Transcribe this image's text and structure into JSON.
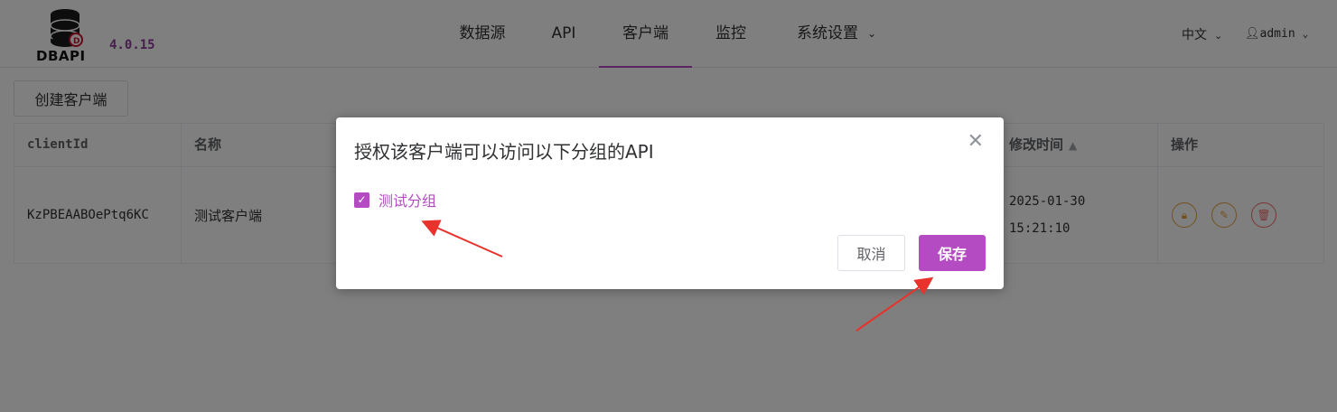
{
  "header": {
    "logo_text": "DBAPI",
    "version": "4.0.15",
    "nav": [
      {
        "label": "数据源"
      },
      {
        "label": "API"
      },
      {
        "label": "客户端"
      },
      {
        "label": "监控"
      },
      {
        "label": "系统设置"
      }
    ],
    "language": "中文",
    "user": "admin"
  },
  "toolbar": {
    "create_label": "创建客户端"
  },
  "table": {
    "columns": [
      "clientId",
      "名称",
      "修改时间",
      "操作"
    ],
    "rows": [
      {
        "client_id": "KzPBEAABOePtq6KC",
        "name": "测试客户端",
        "modified_date": "2025-01-30",
        "modified_time": "15:21:10"
      }
    ]
  },
  "dialog": {
    "title": "授权该客户端可以访问以下分组的API",
    "groups": [
      {
        "label": "测试分组",
        "checked": true
      }
    ],
    "cancel_label": "取消",
    "save_label": "保存"
  },
  "colors": {
    "accent": "#b44bc2",
    "version": "#8e3a9c",
    "arrow": "#e8322b",
    "op_lock": "#e6a23c",
    "op_edit": "#e6a23c",
    "op_delete": "#f56c6c"
  },
  "icons": {
    "lock": "lock-icon",
    "edit": "edit-icon",
    "delete": "trash-icon",
    "user": "user-icon",
    "close": "close-icon",
    "sort": "sort-icon"
  }
}
